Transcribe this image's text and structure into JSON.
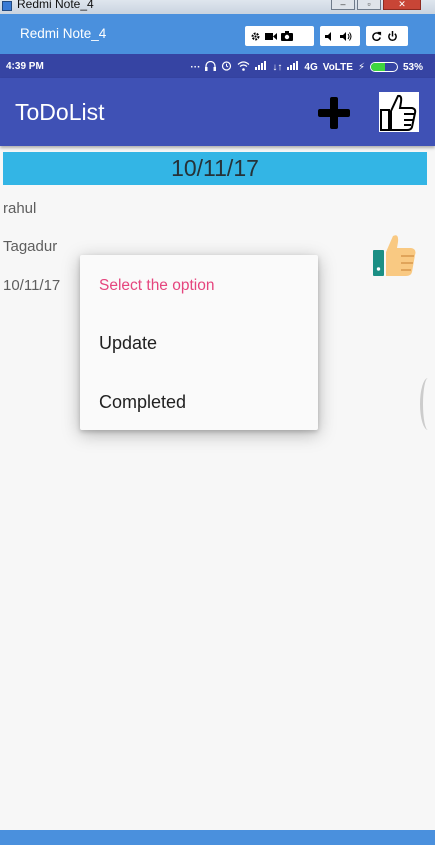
{
  "window": {
    "title": "Redmi Note_4",
    "minimize": "–",
    "maximize": "▫",
    "close": "✕"
  },
  "emulator": {
    "title": "Redmi Note_4",
    "controls": [
      "gear-icon",
      "video-icon",
      "camera-icon",
      "volume-down-icon",
      "volume-up-icon",
      "rotate-icon",
      "power-icon"
    ]
  },
  "status_bar": {
    "time": "4:39 PM",
    "network": "4G",
    "volte": "VoLTE",
    "battery": "53%",
    "battery_level": 0.53,
    "battery_color": "#3ed63e"
  },
  "app_bar": {
    "title": "ToDoList",
    "background": "#3f51b5"
  },
  "list": {
    "date_header": "10/11/17",
    "header_color": "#33b5e5",
    "task": {
      "name": "rahul",
      "place": "Tagadur",
      "date": "10/11/17"
    }
  },
  "dialog": {
    "title": "Select the option",
    "title_color": "#e5457e",
    "options": [
      "Update",
      "Completed"
    ]
  }
}
